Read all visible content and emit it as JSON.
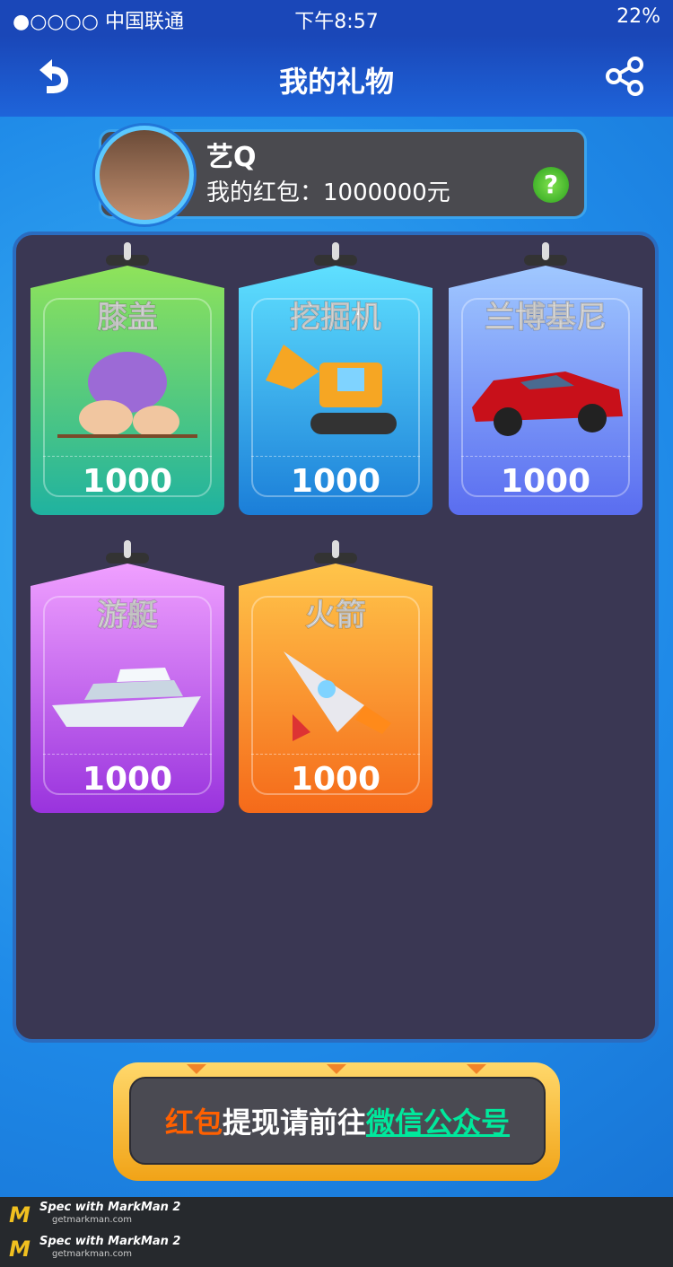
{
  "status_bar": {
    "carrier": "●○○○○ 中国联通",
    "time": "下午8:57",
    "battery": "22%"
  },
  "nav": {
    "title": "我的礼物",
    "back_icon": "back-arrow-icon",
    "share_icon": "share-icon"
  },
  "user": {
    "name": "艺Q",
    "red_packet": "我的红包：1000000元"
  },
  "gifts": [
    {
      "name": "膝盖",
      "price": "1000",
      "color_top": "#8fe35a",
      "color_bottom": "#1fb2a0",
      "icon": "knee-icon"
    },
    {
      "name": "挖掘机",
      "price": "1000",
      "color_top": "#5fe0ff",
      "color_bottom": "#1b7ed8",
      "icon": "excavator-icon"
    },
    {
      "name": "兰博基尼",
      "price": "1000",
      "color_top": "#a0c8ff",
      "color_bottom": "#5a6df0",
      "icon": "lamborghini-icon"
    },
    {
      "name": "游艇",
      "price": "1000",
      "color_top": "#f0a0ff",
      "color_bottom": "#9933dd",
      "icon": "yacht-icon"
    },
    {
      "name": "火箭",
      "price": "1000",
      "color_top": "#ffc54a",
      "color_bottom": "#f56a1a",
      "icon": "rocket-icon"
    }
  ],
  "footer": {
    "part1": "红包",
    "part2": "提现请前往",
    "part3": "微信公众号"
  },
  "markman": {
    "line1": "Spec with MarkMan 2",
    "line2": "getmarkman.com"
  }
}
